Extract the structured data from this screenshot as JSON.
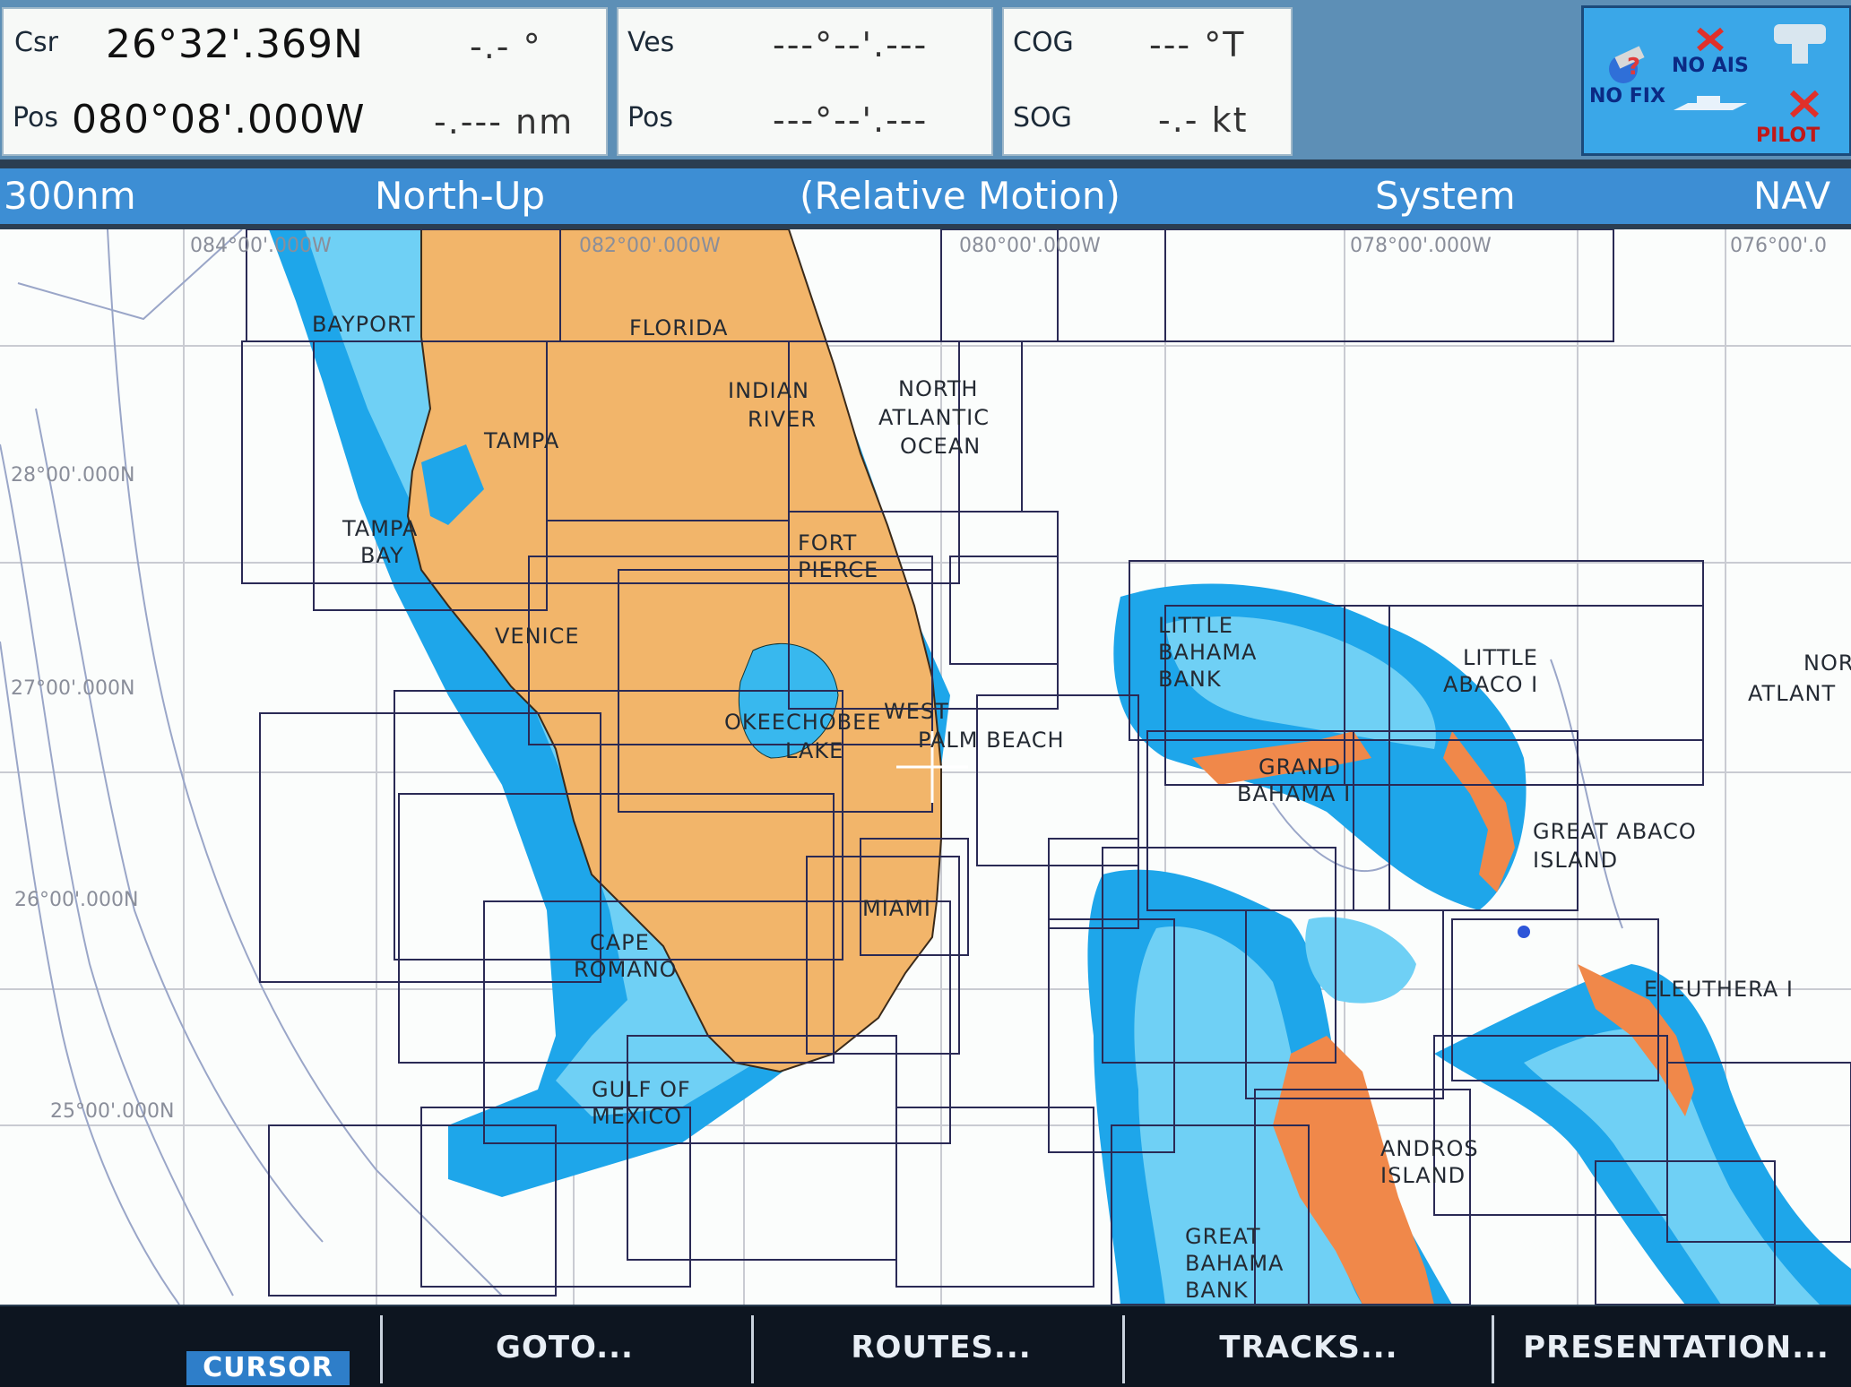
{
  "data_bar": {
    "cursor": {
      "label": "Csr",
      "lat": "26°32'.369N",
      "lon_label": "Pos",
      "lon": "080°08'.000W",
      "bearing": "-.- °",
      "range": "-.--- nm"
    },
    "vessel": {
      "label": "Ves",
      "value": "---°--'.---",
      "pos_label": "Pos",
      "pos_value": "---°--'.---"
    },
    "cog": {
      "label": "COG",
      "value": "--- °T"
    },
    "sog": {
      "label": "SOG",
      "value": "-.- kt"
    }
  },
  "status": {
    "no_fix": "NO FIX",
    "no_ais": "NO AIS",
    "pilot": "PILOT"
  },
  "mode_bar": {
    "range": "300nm",
    "orientation": "North-Up",
    "motion": "(Relative Motion)",
    "system": "System",
    "nav": "NAV"
  },
  "chart": {
    "longitude_labels": [
      "084°00'.000W",
      "082°00'.000W",
      "080°00'.000W",
      "078°00'.000W",
      "076°00'.0"
    ],
    "latitude_labels": [
      "28°00'.000N",
      "27°00'.000N",
      "26°00'.000N",
      "25°00'.000N"
    ],
    "places": {
      "bayport": "BAYPORT",
      "florida": "FLORIDA",
      "indian": "INDIAN",
      "river": "RIVER",
      "north": "NORTH",
      "atlantic": "ATLANTIC",
      "ocean": "OCEAN",
      "tampa": "TAMPA",
      "tampa2": "TAMPA",
      "bay": "BAY",
      "fort": "FORT",
      "pierce": "PIERCE",
      "venice": "VENICE",
      "okeechobee": "OKEECHOBEE",
      "lake": "LAKE",
      "west": "WEST",
      "palm_beach": "PALM BEACH",
      "little": "LITTLE",
      "bahama": "BAHAMA",
      "bank": "BANK",
      "little2": "LITTLE",
      "abaco": "ABACO I",
      "grand": "GRAND",
      "bahama_i": "BAHAMA I",
      "great_abaco": "GREAT ABACO",
      "island": "ISLAND",
      "miami": "MIAMI",
      "cape": "CAPE",
      "romano": "ROMANO",
      "eleuthera": "ELEUTHERA I",
      "gulf_of": "GULF OF",
      "mexico": "MEXICO",
      "andros": "ANDROS",
      "island2": "ISLAND",
      "great": "GREAT",
      "bahama2": "BAHAMA",
      "bank2": "BANK",
      "nor": "NOR",
      "atlant": "ATLANT"
    }
  },
  "softkeys": {
    "cursor": "CURSOR",
    "goto": "GOTO...",
    "routes": "ROUTES...",
    "tracks": "TRACKS...",
    "presentation": "PRESENTATION..."
  },
  "colors": {
    "land": "#f2b56a",
    "shallow": "#1ea6ea",
    "mid_water": "#6fd0f5",
    "deep": "#fbfdfc",
    "bahamas_land": "#f0884a"
  }
}
